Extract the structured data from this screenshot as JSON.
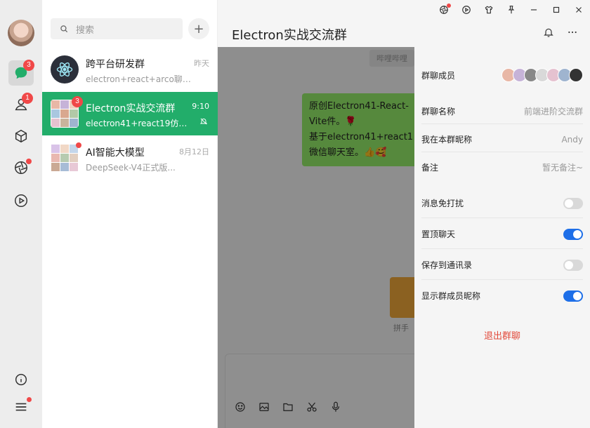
{
  "sidebar": {
    "chat_badge": "3",
    "contacts_badge": "1"
  },
  "search": {
    "placeholder": "搜索"
  },
  "conversations": [
    {
      "name": "跨平台研发群",
      "last_message": "electron+react+arco聊天室",
      "time": "昨天"
    },
    {
      "name": "Electron实战交流群",
      "last_message": "electron41+react19仿微...",
      "time": "9:10",
      "badge": "3"
    },
    {
      "name": "AI智能大模型",
      "last_message": "DeepSeek-V4正式版...",
      "time": "8月12日"
    }
  ],
  "chat": {
    "title": "Electron实战交流群",
    "system_tag": "哔哩哔哩",
    "message": "原创Electron41-React-Vite件。🌹\n基于electron41+react1微信聊天室。👍🥰",
    "card_label": "拼手"
  },
  "panel": {
    "members_label": "群聊成员",
    "group_name_label": "群聊名称",
    "group_name_value": "前端进阶交流群",
    "nickname_label": "我在本群昵称",
    "nickname_value": "Andy",
    "remark_label": "备注",
    "remark_value": "暂无备注~",
    "mute_label": "消息免打扰",
    "mute_on": false,
    "pin_label": "置顶聊天",
    "pin_on": true,
    "save_label": "保存到通讯录",
    "save_on": false,
    "show_nick_label": "显示群成员昵称",
    "show_nick_on": true,
    "exit_label": "退出群聊"
  },
  "colors": {
    "accent_green": "#22ad6a",
    "toggle_on": "#1e6fe8",
    "badge_red": "#f04848",
    "exit_red": "#e24a3b"
  }
}
